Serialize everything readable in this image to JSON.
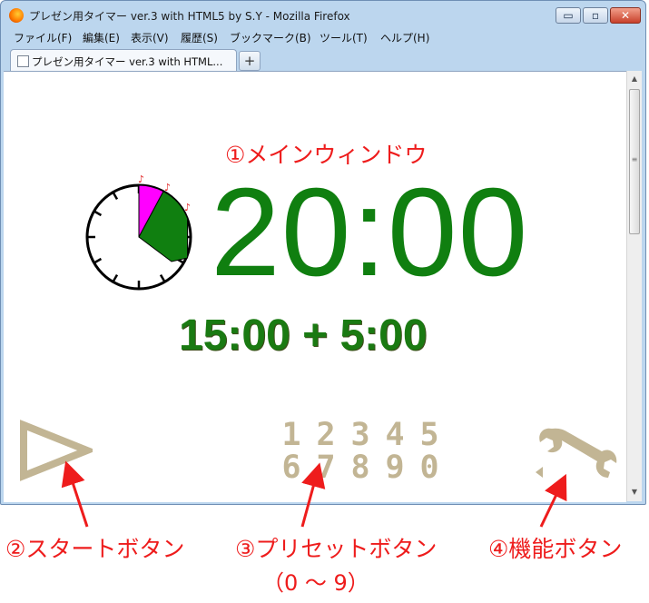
{
  "window": {
    "title": "プレゼン用タイマー ver.3 with HTML5 by S.Y - Mozilla Firefox",
    "controls": {
      "minimize": "▭",
      "maximize": "▫",
      "close": "✕"
    }
  },
  "menu": [
    "ファイル(F)",
    "編集(E)",
    "表示(V)",
    "履歴(S)",
    "ブックマーク(B)",
    "ツール(T)",
    "ヘルプ(H)"
  ],
  "tab": {
    "title": "プレゼン用タイマー ver.3 with HTML...",
    "new_tab": "+"
  },
  "page": {
    "main_window_label": "①メインウィンドウ",
    "timer": "20:00",
    "split": "15:00 + 5:00",
    "presets": [
      "1",
      "2",
      "3",
      "4",
      "5",
      "6",
      "7",
      "8",
      "9",
      "0"
    ],
    "colors": {
      "timer": "#107f10",
      "alarm_segment_1": "#ff00ff",
      "alarm_segment_2": "#107f10",
      "bell": "#e02020",
      "button": "#c2b594"
    },
    "clock": {
      "alarm_marks": [
        "bell-icon",
        "bell-icon",
        "bell-icon"
      ]
    }
  },
  "annotations": {
    "start": "②スタートボタン",
    "presets": "③プリセットボタン",
    "presets_range": "（0 ～ 9）",
    "functions": "④機能ボタン",
    "color": "#ee1c1c"
  },
  "scrollbar": {
    "up": "▲",
    "down": "▼",
    "grip": "≡"
  }
}
